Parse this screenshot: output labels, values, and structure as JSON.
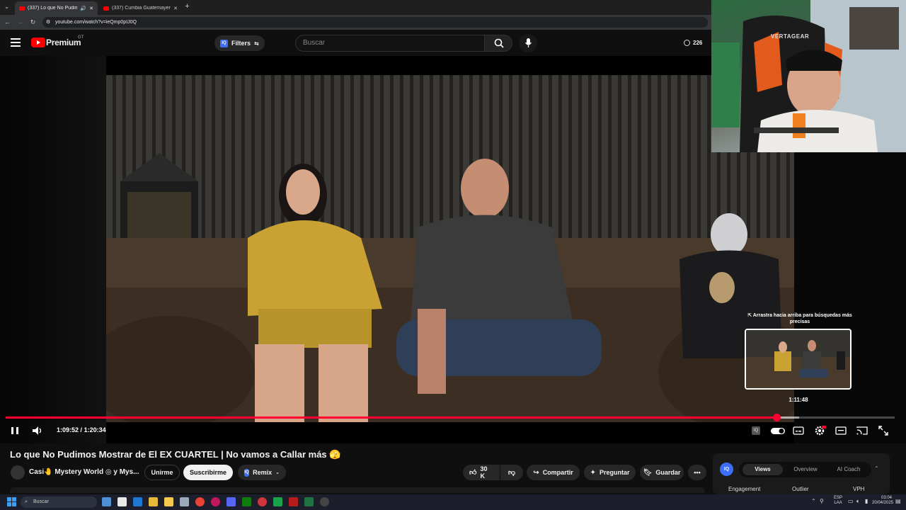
{
  "browser": {
    "tabs": [
      {
        "title": "(337) Lo que No Pudimos M",
        "active": true
      },
      {
        "title": "(337) Cumbia Guatemayense T",
        "active": false
      }
    ],
    "url": "youtube.com/watch?v=ieQmp0pIJ0Q"
  },
  "masthead": {
    "logo_text": "Premium",
    "country_code": "GT",
    "filters_label": "Filters",
    "search_placeholder": "Buscar",
    "notification_count": "226"
  },
  "player": {
    "current_time": "1:09:52",
    "duration": "1:20:34",
    "time_separator": "/",
    "progress_fraction": 0.8672,
    "hover_fraction": 0.8927,
    "hover_time": "1:11:48",
    "drag_hint": "⇱ Arrastra hacia arriba para búsquedas más precisas",
    "ext_badge": "IQ"
  },
  "video": {
    "title": "Lo que No Pudimos Mostrar de El EX CUARTEL | No vamos a Callar más 🫣",
    "channel_name": "Casi🤚 Mystery World ◎ y Mys...",
    "join_label": "Unirme",
    "subscribe_label": "Suscribirme",
    "remix_label": "Remix",
    "like_count": "30 K",
    "share_label": "Compartir",
    "ask_label": "Preguntar",
    "save_label": "Guardar"
  },
  "ext_panel": {
    "badge": "IQ",
    "tabs": [
      "Views",
      "Overview",
      "AI Coach"
    ],
    "active_tab": "Views",
    "columns": [
      "Engagement",
      "Outlier",
      "VPH"
    ]
  },
  "webcam": {
    "chair_brand": "VERTAGEAR"
  },
  "taskbar": {
    "search_placeholder": "Buscar",
    "language": "ESP",
    "layout": "LAA",
    "time": "03:04",
    "date": "20/04/2025"
  },
  "colors": {
    "youtube_red": "#ff0000",
    "progress_red": "#ff0033",
    "background": "#0f0f0f"
  }
}
